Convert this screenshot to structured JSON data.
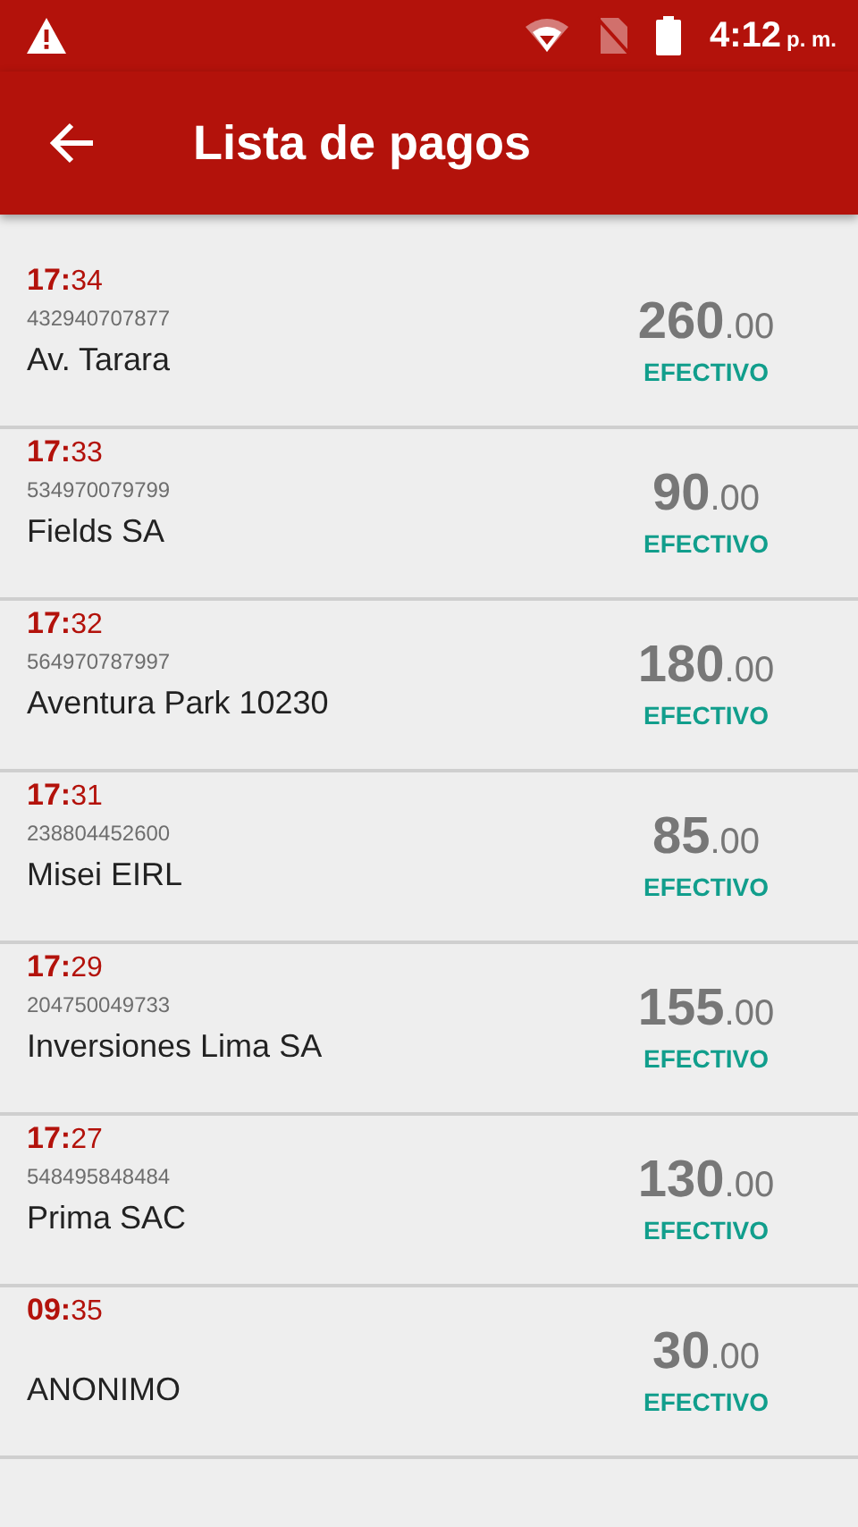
{
  "status_bar": {
    "time": "4:12",
    "ampm": "p. m."
  },
  "app_bar": {
    "title": "Lista de pagos"
  },
  "payments": [
    {
      "hour": "17:",
      "minute": "34",
      "code": "432940707877",
      "name": "Av. Tarara",
      "amount": "260",
      "cents": ".00",
      "method": "EFECTIVO"
    },
    {
      "hour": "17:",
      "minute": "33",
      "code": "534970079799",
      "name": "Fields SA",
      "amount": "90",
      "cents": ".00",
      "method": "EFECTIVO"
    },
    {
      "hour": "17:",
      "minute": "32",
      "code": "564970787997",
      "name": "Aventura Park 10230",
      "amount": "180",
      "cents": ".00",
      "method": "EFECTIVO"
    },
    {
      "hour": "17:",
      "minute": "31",
      "code": "238804452600",
      "name": "Misei EIRL",
      "amount": "85",
      "cents": ".00",
      "method": "EFECTIVO"
    },
    {
      "hour": "17:",
      "minute": "29",
      "code": "204750049733",
      "name": "Inversiones Lima SA",
      "amount": "155",
      "cents": ".00",
      "method": "EFECTIVO"
    },
    {
      "hour": "17:",
      "minute": "27",
      "code": "548495848484",
      "name": "Prima SAC",
      "amount": "130",
      "cents": ".00",
      "method": "EFECTIVO"
    },
    {
      "hour": "09:",
      "minute": "35",
      "name": "ANONIMO",
      "amount": "30",
      "cents": ".00",
      "method": "EFECTIVO"
    }
  ]
}
